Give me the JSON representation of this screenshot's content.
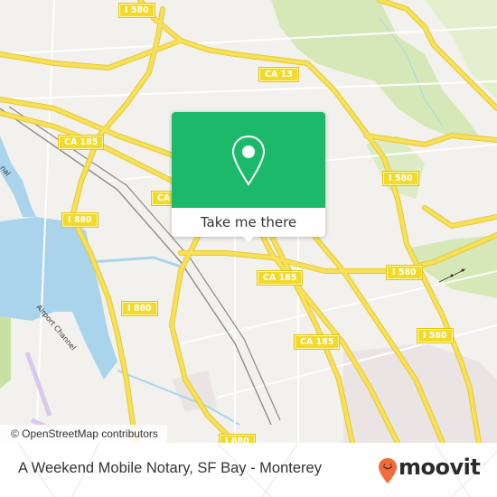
{
  "map": {
    "road_labels": [
      {
        "id": "i580-top",
        "text": "I 580"
      },
      {
        "id": "ca13",
        "text": "CA 13"
      },
      {
        "id": "ca185-west",
        "text": "CA 185"
      },
      {
        "id": "ca-partial",
        "text": "CA"
      },
      {
        "id": "i580-east",
        "text": "I 580"
      },
      {
        "id": "i880-north",
        "text": "I 880"
      },
      {
        "id": "i580-mid",
        "text": "I 580"
      },
      {
        "id": "ca185-center",
        "text": "CA 185"
      },
      {
        "id": "i880-south",
        "text": "I 880"
      },
      {
        "id": "i580-se",
        "text": "I 580"
      },
      {
        "id": "ca185-south",
        "text": "CA 185"
      },
      {
        "id": "i880-bottom",
        "text": "I 880"
      }
    ],
    "water_labels": [
      {
        "id": "airport-channel",
        "text": "Airport Channel"
      },
      {
        "id": "canal-partial",
        "text": "nal"
      }
    ],
    "colors": {
      "land": "#f2f1ed",
      "road": "#f7e05a",
      "road_casing": "#e6c930",
      "water": "#a9d4ec",
      "park": "#cfe4ad",
      "rail": "#8a8a8a"
    }
  },
  "popup": {
    "icon": "map-pin-icon",
    "button_label": "Take me there",
    "accent": "#1db96a"
  },
  "attribution": "© OpenStreetMap contributors",
  "footer": {
    "title": "A Weekend Mobile Notary, SF Bay - Monterey",
    "brand": "moovit",
    "brand_icon": "moovit-smiley-pin-icon",
    "brand_color": "#f26b3a"
  }
}
